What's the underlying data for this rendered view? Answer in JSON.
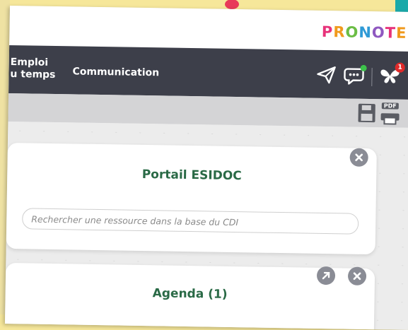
{
  "app": {
    "logo_letters": [
      "P",
      "R",
      "O",
      "N",
      "O",
      "T",
      "E"
    ],
    "logo_colors": [
      "#e7337a",
      "#f09a1d",
      "#6bbd45",
      "#2f9ad6",
      "#8f58c0",
      "#e7337a",
      "#f09a1d"
    ]
  },
  "nav": {
    "emploi_line1": "Emploi",
    "emploi_line2": "u temps",
    "communication": "Communication",
    "notification_count": "1"
  },
  "icons": {
    "send": "paper-plane-icon",
    "messages": "chat-icon",
    "notifications": "butterfly-icon",
    "save": "save-icon",
    "pdf": "pdf-print-icon",
    "close": "close-icon",
    "expand": "expand-arrow-icon"
  },
  "pdf_label": "PDF",
  "esidoc": {
    "title": "Portail ESIDOC",
    "search_placeholder": "Rechercher une ressource dans la base du CDI"
  },
  "agenda": {
    "title": "Agenda (1)"
  },
  "colors": {
    "navbar": "#3d3f4a",
    "title_green": "#2a6a46",
    "badge_red": "#e02a2a",
    "online_green": "#3cc24a"
  }
}
